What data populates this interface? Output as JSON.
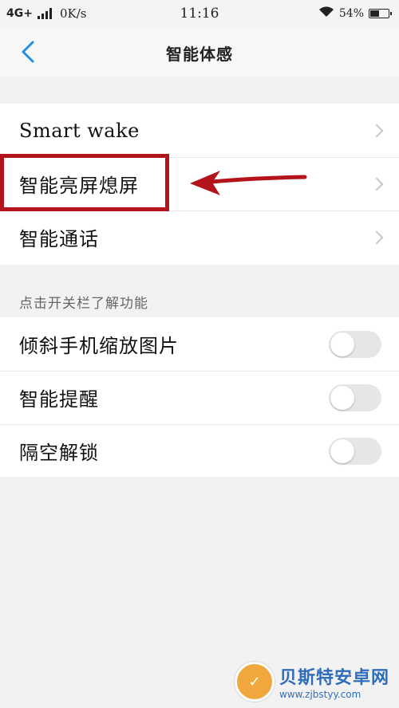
{
  "status_bar": {
    "network": "4G+",
    "speed": "0K/s",
    "time": "11:16",
    "battery": "54%",
    "battery_level": 0.54
  },
  "header": {
    "back_icon": "chevron-left-icon",
    "title": "智能体感",
    "accent_color": "#1e90e6"
  },
  "group_1": {
    "items": [
      {
        "label": "Smart wake"
      },
      {
        "label": "智能亮屏熄屏"
      },
      {
        "label": "智能通话"
      }
    ]
  },
  "section_caption": "点击开关栏了解功能",
  "group_2": {
    "items": [
      {
        "label": "倾斜手机缩放图片",
        "enabled": false
      },
      {
        "label": "智能提醒",
        "enabled": false
      },
      {
        "label": "隔空解锁",
        "enabled": false
      }
    ]
  },
  "annotation": {
    "color": "#b3131b"
  },
  "watermark": {
    "name": "贝斯特安卓网",
    "url": "www.zjbstyy.com"
  }
}
